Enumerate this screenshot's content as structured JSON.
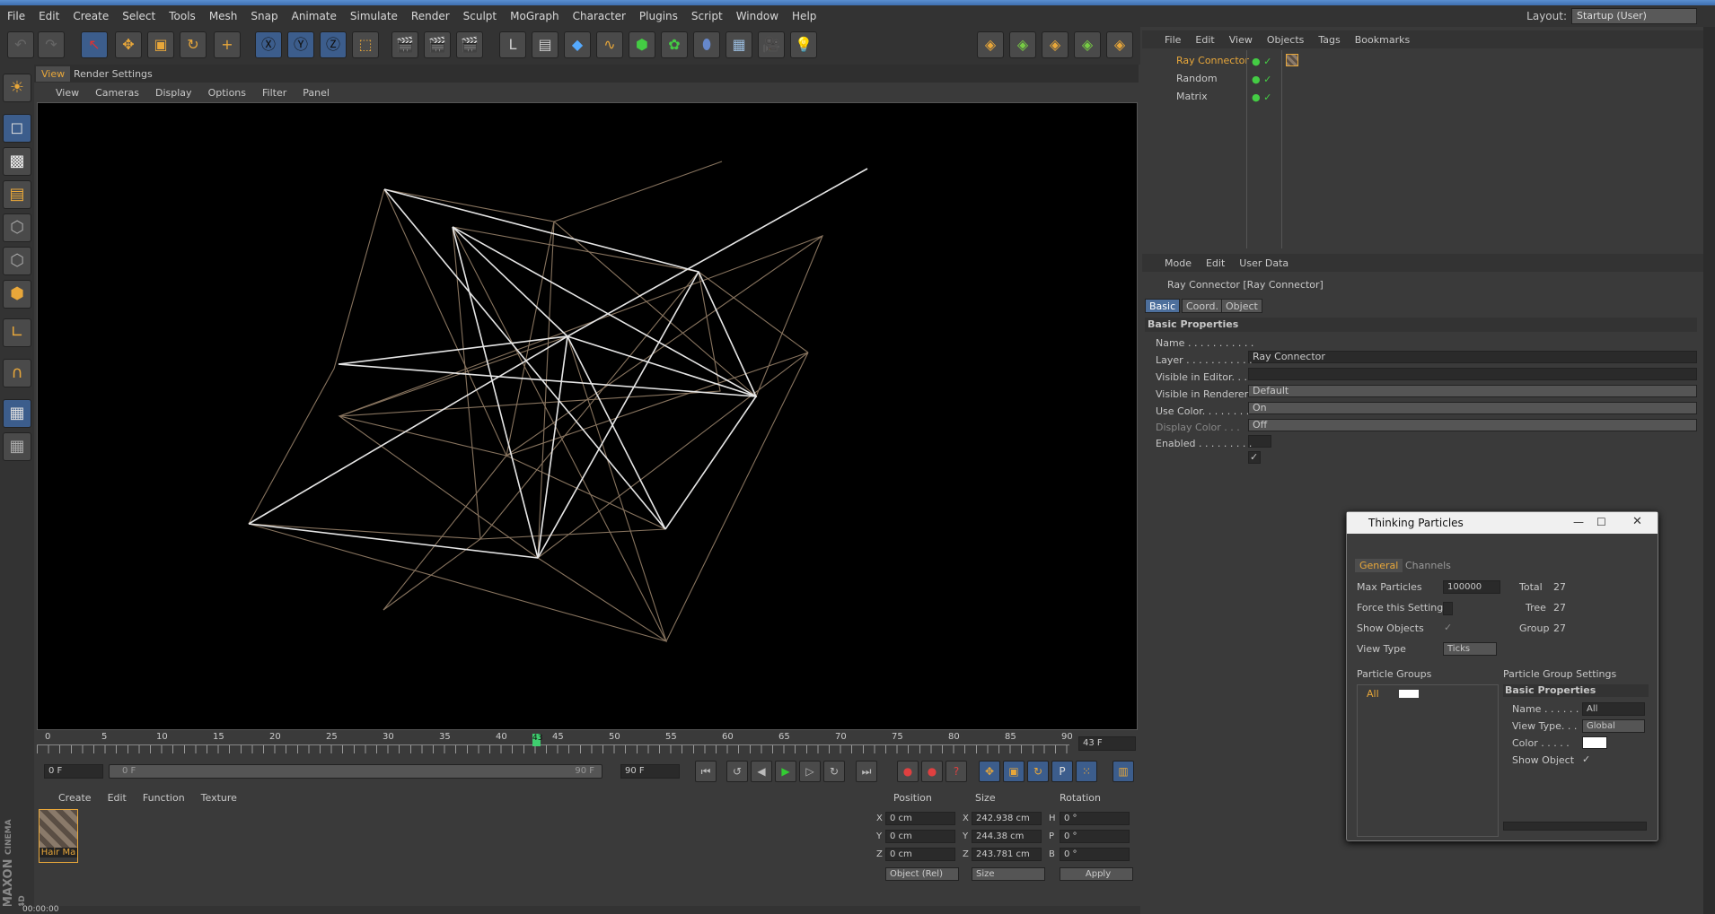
{
  "app": {
    "layout_label": "Layout:",
    "layout_value": "Startup (User)"
  },
  "menu": [
    "File",
    "Edit",
    "Create",
    "Select",
    "Tools",
    "Mesh",
    "Snap",
    "Animate",
    "Simulate",
    "Render",
    "Sculpt",
    "MoGraph",
    "Character",
    "Plugins",
    "Script",
    "Window",
    "Help"
  ],
  "viewport": {
    "tabs": [
      "View",
      "Render Settings"
    ],
    "menu": [
      "View",
      "Cameras",
      "Display",
      "Options",
      "Filter",
      "Panel"
    ]
  },
  "timeline": {
    "ticks": [
      "0",
      "5",
      "10",
      "15",
      "20",
      "25",
      "30",
      "35",
      "40",
      "45",
      "50",
      "55",
      "60",
      "65",
      "70",
      "75",
      "80",
      "85",
      "90"
    ],
    "current_frame_marker": "43",
    "current_frame": "43 F",
    "start_frame": "0 F",
    "range_left": "0 F",
    "range_right": "90 F",
    "end_frame": "90 F"
  },
  "material": {
    "menu": [
      "Create",
      "Edit",
      "Function",
      "Texture"
    ],
    "item_label": "Hair Ma"
  },
  "coords": {
    "headers": [
      "Position",
      "Size",
      "Rotation"
    ],
    "rows": [
      {
        "axis": "X",
        "pos": "0 cm",
        "size_axis": "X",
        "size": "242.938 cm",
        "rot_axis": "H",
        "rot": "0 °"
      },
      {
        "axis": "Y",
        "pos": "0 cm",
        "size_axis": "Y",
        "size": "244.38 cm",
        "rot_axis": "P",
        "rot": "0 °"
      },
      {
        "axis": "Z",
        "pos": "0 cm",
        "size_axis": "Z",
        "size": "243.781 cm",
        "rot_axis": "B",
        "rot": "0 °"
      }
    ],
    "mode": "Object (Rel)",
    "size_mode": "Size",
    "apply": "Apply"
  },
  "status": {
    "text": "00:00:00"
  },
  "brand": {
    "maxon": "MAXON",
    "cinema": "CINEMA 4D"
  },
  "objects": {
    "menu": [
      "File",
      "Edit",
      "View",
      "Objects",
      "Tags",
      "Bookmarks"
    ],
    "items": [
      "Ray Connector",
      "Random",
      "Matrix"
    ]
  },
  "attributes": {
    "menu": [
      "Mode",
      "Edit",
      "User Data"
    ],
    "title": "Ray Connector [Ray Connector]",
    "tabs": [
      "Basic",
      "Coord.",
      "Object"
    ],
    "section": "Basic Properties",
    "props": [
      {
        "label": "Name . . . . . . . . . . .",
        "value": "Ray Connector"
      },
      {
        "label": "Layer . . . . . . . . . . .",
        "value": ""
      },
      {
        "label": "Visible in Editor. . .",
        "value": "Default"
      },
      {
        "label": "Visible in Renderer",
        "value": "On"
      },
      {
        "label": "Use Color. . . . . . . .",
        "value": "Off"
      },
      {
        "label": "Display Color . . .",
        "value": ""
      },
      {
        "label": "Enabled . . . . . . . . .",
        "value": "✓"
      }
    ]
  },
  "tp": {
    "title": "Thinking Particles",
    "tabs": [
      "General",
      "Channels"
    ],
    "max_particles_label": "Max Particles",
    "max_particles": "100000",
    "total_label": "Total",
    "total": "27",
    "force_label": "Force this Setting",
    "tree_label": "Tree",
    "tree": "27",
    "show_objects_label": "Show Objects",
    "group_label": "Group",
    "group": "27",
    "view_type_label": "View Type",
    "view_type": "Ticks",
    "groups_header": "Particle Groups",
    "settings_header": "Particle Group Settings",
    "group_item": "All",
    "basic_props": "Basic Properties",
    "name_label": "Name . . . . . .",
    "name_value": "All",
    "vt_label": "View Type. . .",
    "vt_value": "Global",
    "color_label": "Color . . . . .",
    "show_obj_label": "Show Object"
  }
}
